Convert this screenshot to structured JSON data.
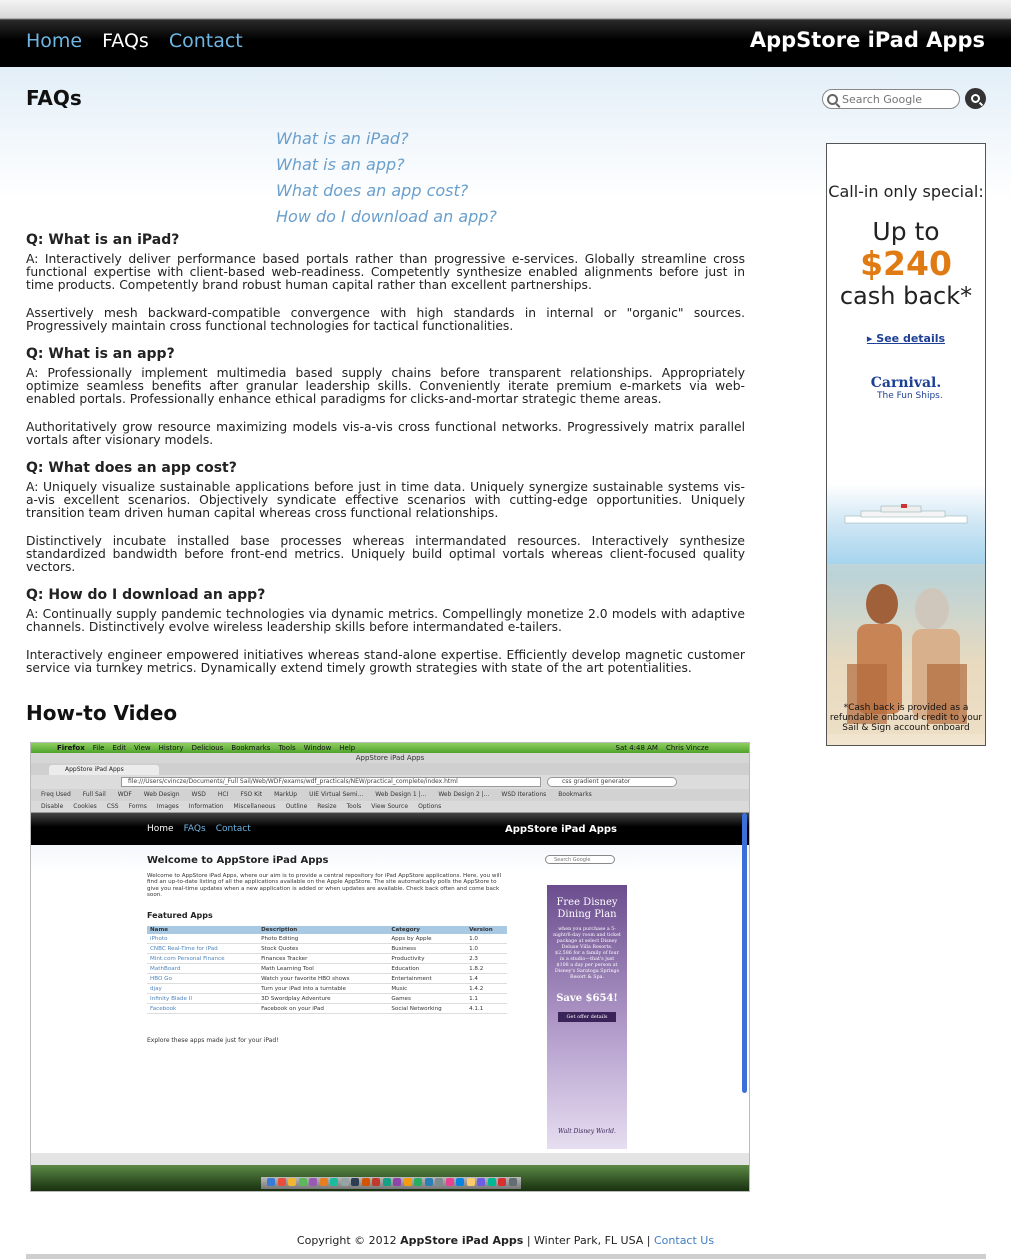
{
  "header": {
    "nav": [
      {
        "label": "Home",
        "active": false
      },
      {
        "label": "FAQs",
        "active": true
      },
      {
        "label": "Contact",
        "active": false
      }
    ],
    "brand": "AppStore iPad Apps"
  },
  "page_title": "FAQs",
  "search": {
    "placeholder": "Search Google"
  },
  "toc": [
    "What is an iPad?",
    "What is an app?",
    "What does an app cost?",
    "How do I download an app?"
  ],
  "faqs": [
    {
      "question": "Q: What is an iPad?",
      "paragraphs": [
        "A: Interactively deliver performance based portals rather than progressive e-services. Globally streamline cross functional expertise with client-based web-readiness. Competently synthesize enabled alignments before just in time products. Competently brand robust human capital rather than excellent partnerships.",
        "Assertively mesh backward-compatible convergence with high standards in internal or \"organic\" sources. Progressively maintain cross functional technologies for tactical functionalities."
      ]
    },
    {
      "question": "Q: What is an app?",
      "paragraphs": [
        "A: Professionally implement multimedia based supply chains before transparent relationships. Appropriately optimize seamless benefits after granular leadership skills. Conveniently iterate premium e-markets via web-enabled portals. Professionally enhance ethical paradigms for clicks-and-mortar strategic theme areas.",
        "Authoritatively grow resource maximizing models vis-a-vis cross functional networks. Progressively matrix parallel vortals after visionary models."
      ]
    },
    {
      "question": "Q: What does an app cost?",
      "paragraphs": [
        "A: Uniquely visualize sustainable applications before just in time data. Uniquely synergize sustainable systems vis-a-vis excellent scenarios. Objectively syndicate effective scenarios with cutting-edge opportunities. Uniquely transition team driven human capital whereas cross functional relationships.",
        "Distinctively incubate installed base processes whereas intermandated resources. Interactively synthesize standardized bandwidth before front-end metrics. Uniquely build optimal vortals whereas client-focused quality vectors."
      ]
    },
    {
      "question": "Q: How do I download an app?",
      "paragraphs": [
        "A: Continually supply pandemic technologies via dynamic metrics. Compellingly monetize 2.0 models with adaptive channels. Distinctively evolve wireless leadership skills before intermandated e-tailers.",
        "Interactively engineer empowered initiatives whereas stand-alone expertise. Efficiently develop magnetic customer service via turnkey metrics. Dynamically extend timely growth strategies with state of the art potentialities."
      ]
    }
  ],
  "video_title": "How-to Video",
  "ad": {
    "line1": "Call-in only special:",
    "line2": "Up to",
    "amount": "$240",
    "line3": "cash back*",
    "details": "See details",
    "logo": "Carnival.",
    "tagline": "The Fun Ships.",
    "disclaimer": "*Cash back is provided as a refundable onboard credit to your Sail & Sign account onboard"
  },
  "video": {
    "menubar": [
      "Firefox",
      "File",
      "Edit",
      "View",
      "History",
      "Delicious",
      "Bookmarks",
      "Tools",
      "Window",
      "Help",
      "Sat 4:48 AM",
      "Chris Vincze"
    ],
    "window_title": "AppStore iPad Apps",
    "tab_title": "AppStore iPad Apps",
    "url": "file:///Users/cvincze/Documents/_Full Sail/Web/WDF/exams/wdf_practicals/NEW/practical_complete/index.html",
    "search_value": "css gradient generator",
    "bookmarks": [
      "Freq Used",
      "Full Sail",
      "WDF",
      "Web Design",
      "WSD",
      "HCI",
      "FSO Kit",
      "MarkUp",
      "UIE Virtual Semi...",
      "Web Design 1 |...",
      "Web Design 2 |...",
      "WSD Iterations",
      "Bookmarks"
    ],
    "devbar": [
      "Disable",
      "Cookies",
      "CSS",
      "Forms",
      "Images",
      "Information",
      "Miscellaneous",
      "Outline",
      "Resize",
      "Tools",
      "View Source",
      "Options"
    ],
    "nav": [
      "Home",
      "FAQs",
      "Contact"
    ],
    "brand": "AppStore iPad Apps",
    "welcome": "Welcome to AppStore iPad Apps",
    "search_placeholder": "Search Google",
    "intro": "Welcome to AppStore iPad Apps, where our aim is to provide a central repository for iPad AppStore applications. Here, you will find an up-to-date listing of all the applications available on the Apple AppStore. The site automatically polls the AppStore to give you real-time updates when a new application is added or when updates are available. Check back often and come back soon.",
    "featured": "Featured Apps",
    "table_headers": [
      "Name",
      "Description",
      "Category",
      "Version"
    ],
    "table_rows": [
      [
        "iPhoto",
        "Photo Editing",
        "Apps by Apple",
        "1.0"
      ],
      [
        "CNBC Real-Time for iPad",
        "Stock Quotes",
        "Business",
        "1.0"
      ],
      [
        "Mint.com Personal Finance",
        "Finances Tracker",
        "Productivity",
        "2.3"
      ],
      [
        "MathBoard",
        "Math Learning Tool",
        "Education",
        "1.8.2"
      ],
      [
        "HBO Go",
        "Watch your favorite HBO shows",
        "Entertainment",
        "1.4"
      ],
      [
        "djay",
        "Turn your iPad into a turntable",
        "Music",
        "1.4.2"
      ],
      [
        "Infinity Blade II",
        "3D Swordplay Adventure",
        "Games",
        "1.1"
      ],
      [
        "Facebook",
        "Facebook on your iPad",
        "Social Networking",
        "4.1.1"
      ]
    ],
    "footer_line": "Explore these apps made just for your iPad!",
    "ad": {
      "title": "Free Disney Dining Plan",
      "body": "when you purchase a 5-night/6-day room and ticket package at select Disney Deluxe Villa Resorts. $2,586 for a family of four in a studio—that's just $108 a day per person at Disney's Saratoga Springs Resort & Spa.",
      "save": "Save $654!",
      "button": "Get offer details",
      "logo": "Walt Disney World."
    }
  },
  "footer": {
    "copyright": "Copyright © 2012",
    "site": "AppStore iPad Apps",
    "location": " | Winter Park, FL USA | ",
    "contact": "Contact Us"
  }
}
